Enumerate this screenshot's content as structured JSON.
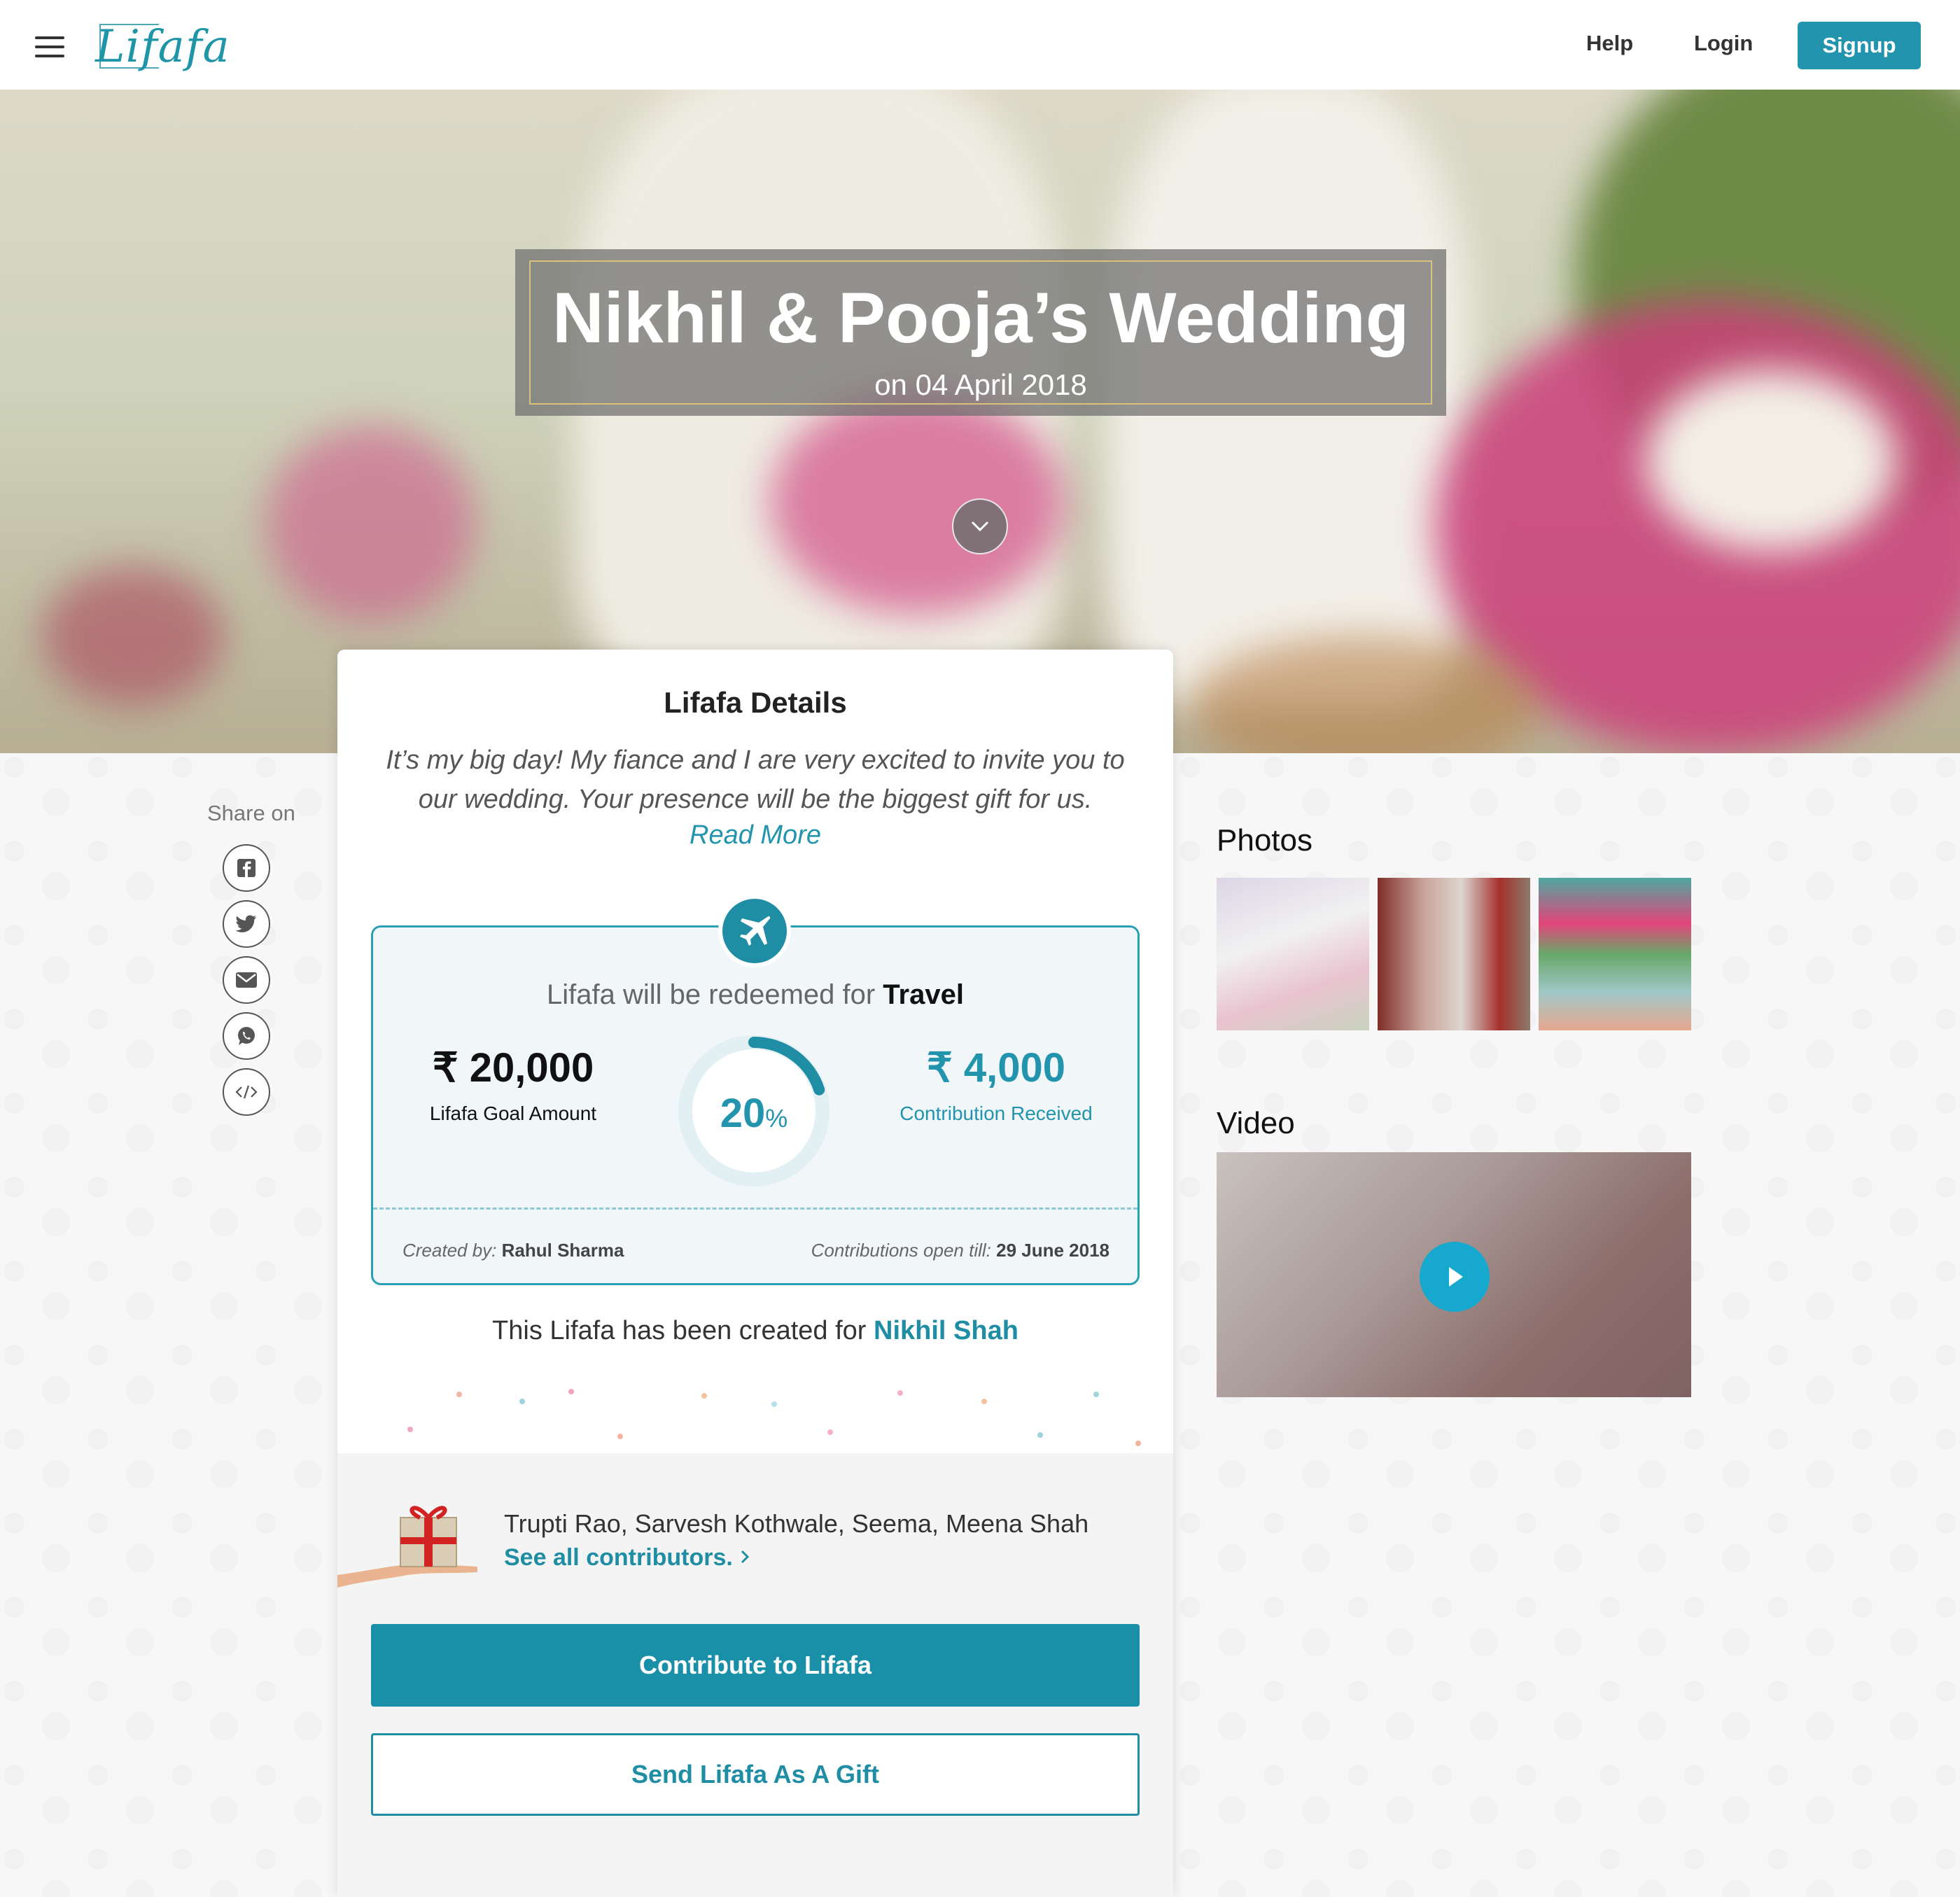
{
  "header": {
    "logo": "Lifafa",
    "nav": {
      "help": "Help",
      "login": "Login",
      "signup": "Signup"
    }
  },
  "hero": {
    "title": "Nikhil & Pooja’s Wedding",
    "subtitle": "on 04 April 2018"
  },
  "share": {
    "label": "Share on",
    "icons": [
      "facebook-icon",
      "twitter-icon",
      "email-icon",
      "whatsapp-icon",
      "embed-icon"
    ]
  },
  "card": {
    "title": "Lifafa Details",
    "description": "It’s my big day! My fiance and I are very excited to invite you to our wedding. Your presence will be the biggest gift for us.",
    "read_more": "Read More",
    "redeem_prefix": "Lifafa will be redeemed for",
    "redeem_category": "Travel",
    "goal_amount": "₹ 20,000",
    "goal_label": "Lifafa Goal Amount",
    "progress_percent": "20",
    "progress_fraction": 0.2,
    "percent_sign": "%",
    "received_amount": "₹ 4,000",
    "received_label": "Contribution Received",
    "created_by_label": "Created by:",
    "created_by": "Rahul Sharma",
    "open_till_label": "Contributions open till:",
    "open_till": "29 June 2018",
    "created_for_prefix": "This Lifafa has been created for",
    "created_for": "Nikhil Shah",
    "contributors": "Trupti Rao, Sarvesh Kothwale, Seema, Meena Shah",
    "see_all": "See all contributors.",
    "contribute_button": "Contribute to Lifafa",
    "gift_button": "Send Lifafa As A Gift"
  },
  "media": {
    "photos_title": "Photos",
    "video_title": "Video"
  },
  "colors": {
    "accent": "#2394ad",
    "accent_dark": "#1a90a8",
    "title_border": "#d9c178"
  }
}
